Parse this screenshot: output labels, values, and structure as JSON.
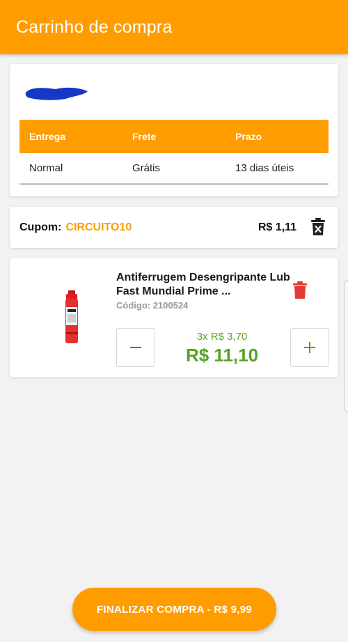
{
  "header": {
    "title": "Carrinho de compra"
  },
  "shipping": {
    "headers": [
      "Entrega",
      "Frete",
      "Prazo"
    ],
    "row": [
      "Normal",
      "Grátis",
      "13 dias úteis"
    ]
  },
  "coupon": {
    "label": "Cupom:",
    "code": "CIRCUITO10",
    "value": "R$ 1,11",
    "delete_icon": "trash-icon"
  },
  "item": {
    "title": "Antiferrugem Desengripante Lub Fast Mundial Prime ...",
    "code": "Código: 2100524",
    "unit_price": "3x R$ 3,70",
    "total_price": "R$ 11,10",
    "minus_symbol": "−",
    "plus_symbol": "+",
    "delete_icon": "trash-icon"
  },
  "checkout": {
    "label": "FINALIZAR COMPRA - R$ 9,99"
  },
  "colors": {
    "primary": "#ff9c00",
    "price": "#56a324",
    "delete": "#e53935"
  }
}
